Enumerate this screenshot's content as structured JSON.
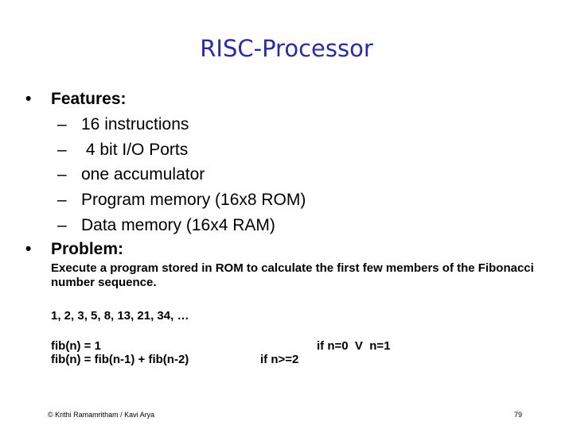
{
  "slide": {
    "title": "RISC-Processor",
    "bullets": [
      {
        "marker": "•",
        "label": "Features:",
        "items": [
          "16 instructions",
          " 4 bit I/O Ports",
          "one accumulator",
          "Program memory (16x8 ROM)",
          "Data memory (16x4 RAM)"
        ]
      },
      {
        "marker": "•",
        "label": "Problem:"
      }
    ],
    "dash": "–",
    "problem_text": "Execute a program stored in ROM to calculate the first few members of the Fibonacci number sequence.",
    "sequence": "1, 2, 3, 5, 8, 13, 21, 34, …",
    "formulas": [
      {
        "expr": "fib(n) = 1",
        "condition": "if n=0  V  n=1"
      },
      {
        "expr": "fib(n) = fib(n-1) + fib(n-2)",
        "condition": "if n>=2"
      }
    ],
    "footer": "© Krithi Ramamritham / Kavi Arya",
    "page_number": "79"
  }
}
